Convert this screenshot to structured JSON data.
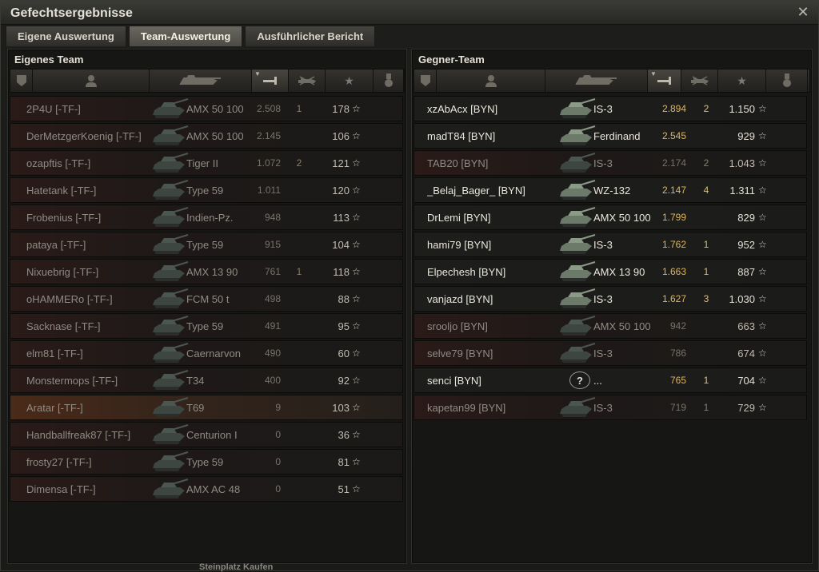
{
  "window": {
    "title": "Gefechtsergebnisse",
    "close_icon": "close-icon"
  },
  "tabs": [
    {
      "label": "Eigene Auswertung",
      "active": false
    },
    {
      "label": "Team-Auswertung",
      "active": true
    },
    {
      "label": "Ausführlicher Bericht",
      "active": false
    }
  ],
  "own_team": {
    "title": "Eigenes Team",
    "rows": [
      {
        "name": "2P4U [-TF-]",
        "tank": "AMX 50 100",
        "damage": "2.508",
        "kills": "1",
        "xp": "178",
        "alive": false,
        "highlight": false
      },
      {
        "name": "DerMetzgerKoenig [-TF-]",
        "tank": "AMX 50 100",
        "damage": "2.145",
        "kills": "",
        "xp": "106",
        "alive": false,
        "highlight": false
      },
      {
        "name": "ozapftis [-TF-]",
        "tank": "Tiger II",
        "damage": "1.072",
        "kills": "2",
        "xp": "121",
        "alive": false,
        "highlight": false
      },
      {
        "name": "Hatetank [-TF-]",
        "tank": "Type 59",
        "damage": "1.011",
        "kills": "",
        "xp": "120",
        "alive": false,
        "highlight": false
      },
      {
        "name": "Frobenius [-TF-]",
        "tank": "Indien-Pz.",
        "damage": "948",
        "kills": "",
        "xp": "113",
        "alive": false,
        "highlight": false
      },
      {
        "name": "pataya [-TF-]",
        "tank": "Type 59",
        "damage": "915",
        "kills": "",
        "xp": "104",
        "alive": false,
        "highlight": false
      },
      {
        "name": "Nixuebrig [-TF-]",
        "tank": "AMX 13 90",
        "damage": "761",
        "kills": "1",
        "xp": "118",
        "alive": false,
        "highlight": false
      },
      {
        "name": "oHAMMERo [-TF-]",
        "tank": "FCM 50 t",
        "damage": "498",
        "kills": "",
        "xp": "88",
        "alive": false,
        "highlight": false
      },
      {
        "name": "Sacknase [-TF-]",
        "tank": "Type 59",
        "damage": "491",
        "kills": "",
        "xp": "95",
        "alive": false,
        "highlight": false
      },
      {
        "name": "elm81 [-TF-]",
        "tank": "Caernarvon",
        "damage": "490",
        "kills": "",
        "xp": "60",
        "alive": false,
        "highlight": false
      },
      {
        "name": "Monstermops [-TF-]",
        "tank": "T34",
        "damage": "400",
        "kills": "",
        "xp": "92",
        "alive": false,
        "highlight": false
      },
      {
        "name": "Aratar [-TF-]",
        "tank": "T69",
        "damage": "9",
        "kills": "",
        "xp": "103",
        "alive": false,
        "highlight": true
      },
      {
        "name": "Handballfreak87 [-TF-]",
        "tank": "Centurion I",
        "damage": "0",
        "kills": "",
        "xp": "36",
        "alive": false,
        "highlight": false
      },
      {
        "name": "frosty27 [-TF-]",
        "tank": "Type 59",
        "damage": "0",
        "kills": "",
        "xp": "81",
        "alive": false,
        "highlight": false
      },
      {
        "name": "Dimensa [-TF-]",
        "tank": "AMX AC 48",
        "damage": "0",
        "kills": "",
        "xp": "51",
        "alive": false,
        "highlight": false
      }
    ]
  },
  "enemy_team": {
    "title": "Gegner-Team",
    "rows": [
      {
        "name": "xzAbAcx [BYN]",
        "tank": "IS-3",
        "damage": "2.894",
        "kills": "2",
        "xp": "1.150",
        "alive": true
      },
      {
        "name": "madT84 [BYN]",
        "tank": "Ferdinand",
        "damage": "2.545",
        "kills": "",
        "xp": "929",
        "alive": true
      },
      {
        "name": "TAB20 [BYN]",
        "tank": "IS-3",
        "damage": "2.174",
        "kills": "2",
        "xp": "1.043",
        "alive": false
      },
      {
        "name": "_Belaj_Bager_ [BYN]",
        "tank": "WZ-132",
        "damage": "2.147",
        "kills": "4",
        "xp": "1.311",
        "alive": true
      },
      {
        "name": "DrLemi [BYN]",
        "tank": "AMX 50 100",
        "damage": "1.799",
        "kills": "",
        "xp": "829",
        "alive": true
      },
      {
        "name": "hami79 [BYN]",
        "tank": "IS-3",
        "damage": "1.762",
        "kills": "1",
        "xp": "952",
        "alive": true
      },
      {
        "name": "Elpechesh [BYN]",
        "tank": "AMX 13 90",
        "damage": "1.663",
        "kills": "1",
        "xp": "887",
        "alive": true
      },
      {
        "name": "vanjazd [BYN]",
        "tank": "IS-3",
        "damage": "1.627",
        "kills": "3",
        "xp": "1.030",
        "alive": true
      },
      {
        "name": "srooljo [BYN]",
        "tank": "AMX 50 100",
        "damage": "942",
        "kills": "",
        "xp": "663",
        "alive": false
      },
      {
        "name": "selve79 [BYN]",
        "tank": "IS-3",
        "damage": "786",
        "kills": "",
        "xp": "674",
        "alive": false
      },
      {
        "name": "senci [BYN]",
        "tank": "...",
        "damage": "765",
        "kills": "1",
        "xp": "704",
        "alive": true,
        "unknown": true
      },
      {
        "name": "kapetan99 [BYN]",
        "tank": "IS-3",
        "damage": "719",
        "kills": "1",
        "xp": "729",
        "alive": false
      }
    ]
  },
  "background_text": "Steinplatz Kaufen",
  "colors": {
    "alive_text": "#e9e6dc",
    "dead_text": "#8f8b82",
    "damage_alive": "#e0b65a",
    "highlight_row": "#4a2a18"
  }
}
